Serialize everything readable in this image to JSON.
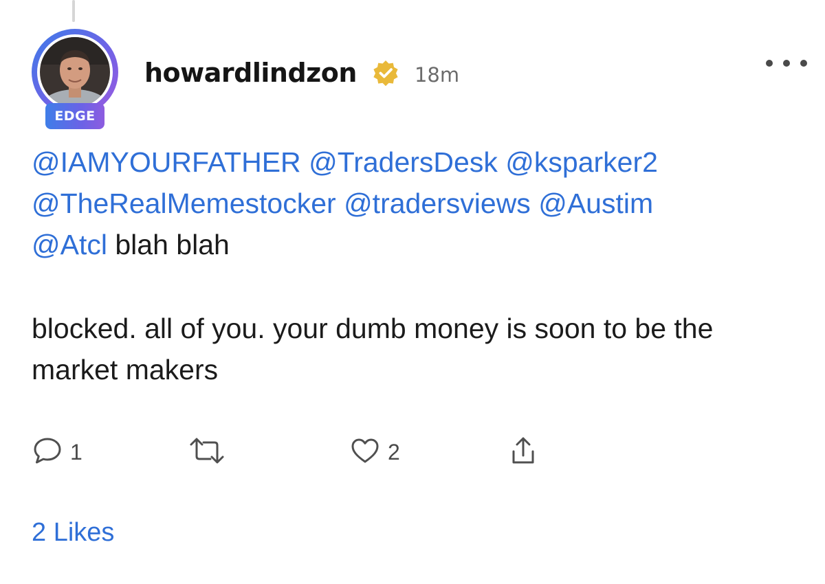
{
  "post": {
    "author": {
      "username": "howardlindzon",
      "badge": "EDGE",
      "verified_icon": "verified-badge-icon",
      "timestamp": "18m"
    },
    "body": {
      "mentions_line1": [
        "@IAMYOURFATHER",
        "@TradersDesk",
        "@ksparker2"
      ],
      "mentions_line2": [
        "@TheRealMemestocker",
        "@tradersviews",
        "@Austim"
      ],
      "mentions_line3": [
        "@Atcl"
      ],
      "line3_text": "blah blah",
      "paragraph2": "blocked. all of you. your dumb money is soon to be the market makers"
    },
    "actions": {
      "reply_count": "1",
      "like_count": "2"
    },
    "likes_summary": "2 Likes"
  },
  "colors": {
    "mention": "#2f6fd7",
    "badge_gradient_start": "#3f7ee8",
    "badge_gradient_end": "#8d5ce0",
    "verified_gold": "#e9b93a"
  }
}
